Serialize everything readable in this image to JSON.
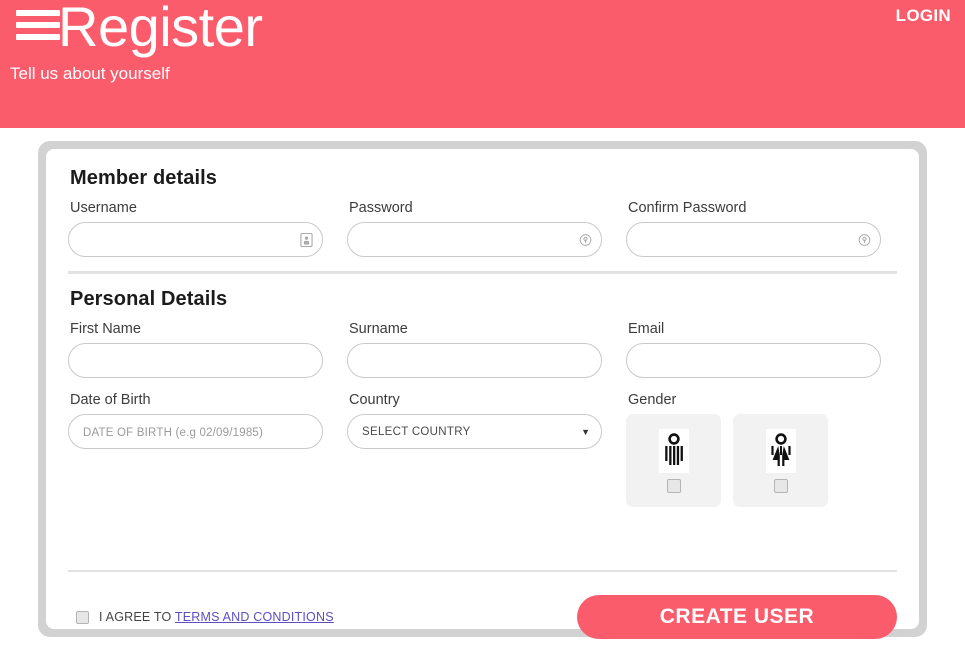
{
  "header": {
    "menu_icon": "hamburger-menu-icon",
    "title": "Register",
    "subtitle": "Tell us about yourself",
    "login_label": "LOGIN",
    "background_color": "#fb5c6c"
  },
  "member_section": {
    "title": "Member details",
    "fields": [
      {
        "label": "Username",
        "value": "",
        "placeholder": "",
        "icon": "id-badge-icon"
      },
      {
        "label": "Password",
        "value": "",
        "placeholder": "",
        "icon": "lock-circle-icon"
      },
      {
        "label": "Confirm Password",
        "value": "",
        "placeholder": "",
        "icon": "lock-circle-icon"
      }
    ]
  },
  "personal_section": {
    "title": "Personal Details",
    "fields": [
      {
        "label": "First Name",
        "value": "",
        "placeholder": ""
      },
      {
        "label": "Surname",
        "value": "",
        "placeholder": ""
      },
      {
        "label": "Email",
        "value": "",
        "placeholder": ""
      }
    ],
    "dob": {
      "label": "Date of Birth",
      "value": "",
      "placeholder": "DATE OF BIRTH (e.g 02/09/1985)"
    },
    "country": {
      "label": "Country",
      "selected": "SELECT COUNTRY",
      "caret_icon": "chevron-down-icon"
    },
    "gender": {
      "label": "Gender",
      "options": [
        {
          "name": "male",
          "icon": "male-pictogram-icon",
          "checked": false
        },
        {
          "name": "female",
          "icon": "female-pictogram-icon",
          "checked": false
        }
      ]
    }
  },
  "footer": {
    "agree_prefix": "I AGREE TO ",
    "terms_link": "TERMS AND CONDITIONS",
    "agree_checked": false,
    "submit_label": "CREATE USER",
    "submit_color": "#fb5c6c",
    "link_color": "#5b4fc4"
  }
}
